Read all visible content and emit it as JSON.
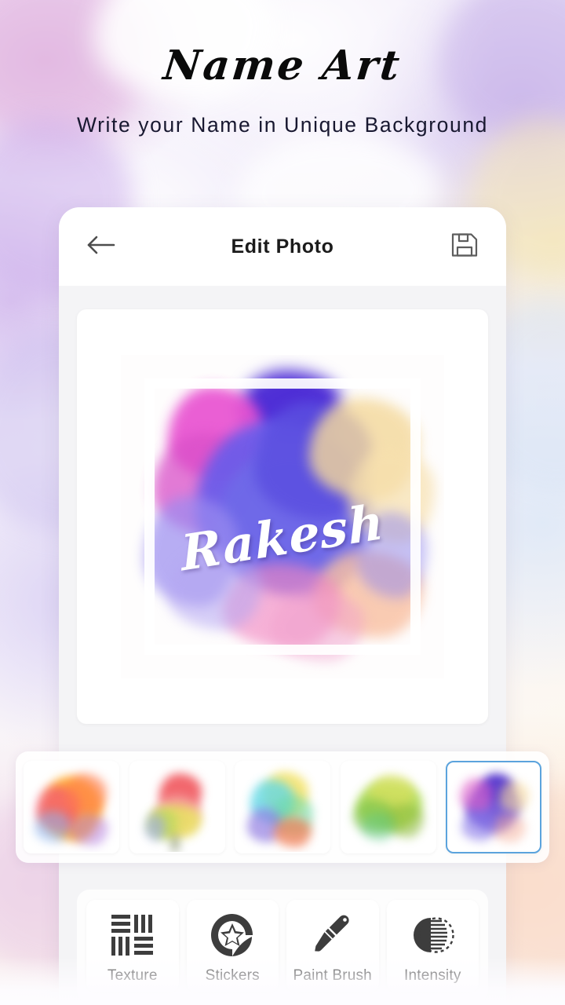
{
  "hero": {
    "title": "Name Art",
    "subtitle": "Write your Name in Unique Background"
  },
  "appbar": {
    "title": "Edit Photo",
    "back_icon": "arrow-left-icon",
    "save_icon": "floppy-save-icon"
  },
  "canvas": {
    "name_text": "Rakesh",
    "frame_color": "#ffffff",
    "text_color": "#ffffff"
  },
  "backgrounds": {
    "selected_index": 4,
    "selection_color": "#5ba3dd",
    "items": [
      {
        "id": "bg-1",
        "label": "Orange Yellow Splash",
        "colors": [
          "#ffb23d",
          "#ff7a4d",
          "#f0457e",
          "#8ab4f0",
          "#b07ae0"
        ]
      },
      {
        "id": "bg-2",
        "label": "Tulip Flower Splash",
        "colors": [
          "#f2686e",
          "#f6a9a6",
          "#e9e060",
          "#b8d95e",
          "#9aa7e8"
        ]
      },
      {
        "id": "bg-3",
        "label": "Rainbow Splash",
        "colors": [
          "#5fd8e8",
          "#f2e05e",
          "#8f7ae0",
          "#f2784e",
          "#6fd9a6"
        ]
      },
      {
        "id": "bg-4",
        "label": "Green Splash",
        "colors": [
          "#a8d94a",
          "#7dc24a",
          "#d9e05e",
          "#5fc98a",
          "#8cb93a"
        ]
      },
      {
        "id": "bg-5",
        "label": "Purple Blue Splash",
        "colors": [
          "#6a4fd8",
          "#8a7ae8",
          "#e060c8",
          "#f6d898",
          "#f6b09a"
        ]
      }
    ]
  },
  "toolbar": {
    "items": [
      {
        "label": "Texture",
        "icon": "texture-weave-icon"
      },
      {
        "label": "Stickers",
        "icon": "sticker-star-icon"
      },
      {
        "label": "Paint Brush",
        "icon": "paint-brush-icon"
      },
      {
        "label": "Intensity",
        "icon": "contrast-intensity-icon"
      }
    ]
  }
}
